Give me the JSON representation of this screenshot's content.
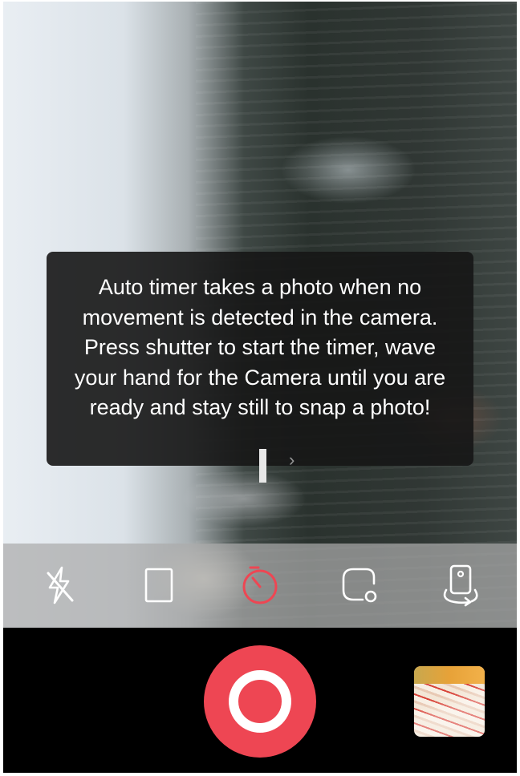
{
  "tooltip": {
    "text": "Auto timer takes a photo when no movement is detected in the camera. Press shutter to start the timer, wave your hand for the Camera until you are ready and stay still to snap a photo!"
  },
  "toolbar": {
    "items": [
      {
        "icon": "flash-off-icon",
        "active": false
      },
      {
        "icon": "aspect-ratio-icon",
        "active": false
      },
      {
        "icon": "auto-timer-icon",
        "active": true
      },
      {
        "icon": "focus-exposure-icon",
        "active": false
      },
      {
        "icon": "switch-camera-icon",
        "active": false
      }
    ]
  },
  "colors": {
    "accent": "#ee4653",
    "icon": "#ffffff",
    "toolbar_bg": "#aaaaaa",
    "bottom_bg": "#000000"
  },
  "focus_indicator": {
    "chevron": "›"
  }
}
